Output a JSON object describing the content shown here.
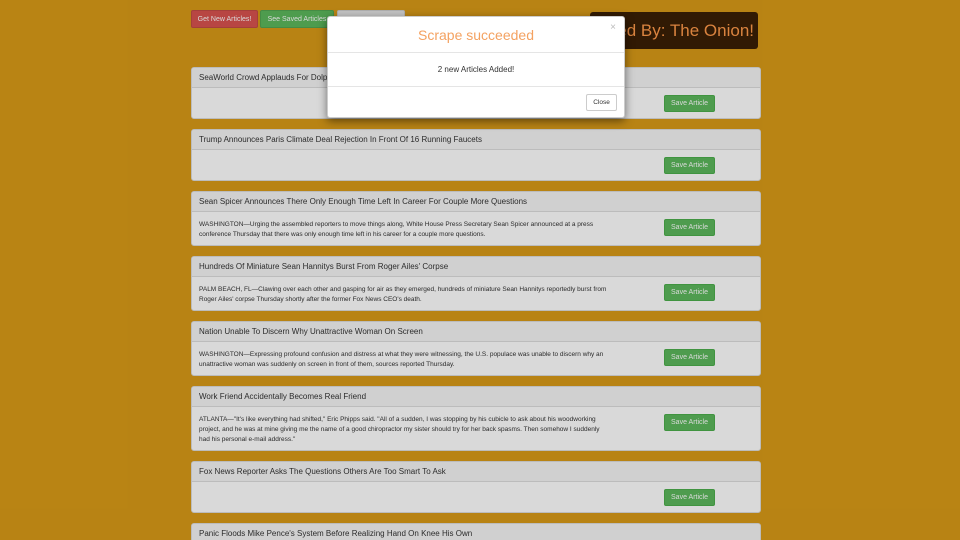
{
  "toolbar": {
    "get_new_label": "Get New Articles!",
    "see_saved_label": "See Saved Articles",
    "third_label": ""
  },
  "header": {
    "powered_by": "Powered By: The Onion!"
  },
  "articles": [
    {
      "title": "SeaWorld Crowd Applauds For Dolphin...",
      "summary": "",
      "save_label": "Save Article"
    },
    {
      "title": "Trump Announces Paris Climate Deal Rejection In Front Of 16 Running Faucets",
      "summary": "",
      "save_label": "Save Article"
    },
    {
      "title": "Sean Spicer Announces There Only Enough Time Left In Career For Couple More Questions",
      "summary": "WASHINGTON—Urging the assembled reporters to move things along, White House Press Secretary Sean Spicer announced at a press conference Thursday that there was only enough time left in his career for a couple more questions.",
      "save_label": "Save Article"
    },
    {
      "title": "Hundreds Of Miniature Sean Hannitys Burst From Roger Ailes' Corpse",
      "summary": "PALM BEACH, FL—Clawing over each other and gasping for air as they emerged, hundreds of miniature Sean Hannitys reportedly burst from Roger Ailes' corpse Thursday shortly after the former Fox News CEO's death.",
      "save_label": "Save Article"
    },
    {
      "title": "Nation Unable To Discern Why Unattractive Woman On Screen",
      "summary": "WASHINGTON—Expressing profound confusion and distress at what they were witnessing, the U.S. populace was unable to discern why an unattractive woman was suddenly on screen in front of them, sources reported Thursday.",
      "save_label": "Save Article"
    },
    {
      "title": "Work Friend Accidentally Becomes Real Friend",
      "summary": "ATLANTA—\"It's like everything had shifted,\" Eric Phipps said. \"All of a sudden, I was stopping by his cubicle to ask about his woodworking project, and he was at mine giving me the name of a good chiropractor my sister should try for her back spasms. Then somehow I suddenly had his personal e-mail address.\"",
      "save_label": "Save Article"
    },
    {
      "title": "Fox News Reporter Asks The Questions Others Are Too Smart To Ask",
      "summary": "",
      "save_label": "Save Article"
    },
    {
      "title": "Panic Floods Mike Pence's System Before Realizing Hand On Knee His Own",
      "summary": "",
      "save_label": ""
    }
  ],
  "modal": {
    "title": "Scrape succeeded",
    "close_x": "×",
    "message": "2 new Articles Added!",
    "close_label": "Close"
  },
  "colors": {
    "background": "#d99b18",
    "modal_title": "#f4a261",
    "save_button": "#5cb85c",
    "get_new_button": "#d9534f"
  }
}
